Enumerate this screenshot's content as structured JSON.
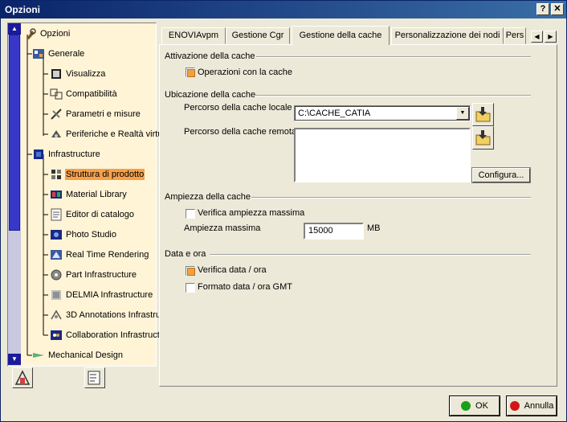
{
  "window": {
    "title": "Opzioni",
    "help_glyph": "?",
    "close_glyph": "✕"
  },
  "tree": {
    "items": [
      {
        "label": "Opzioni",
        "icon": "options-root-icon",
        "level": 0
      },
      {
        "label": "Generale",
        "icon": "general-icon",
        "level": 1
      },
      {
        "label": "Visualizza",
        "icon": "display-icon",
        "level": 2
      },
      {
        "label": "Compatibilità",
        "icon": "compatibility-icon",
        "level": 2
      },
      {
        "label": "Parametri e misure",
        "icon": "parameters-icon",
        "level": 2
      },
      {
        "label": "Periferiche e Realtà virtu",
        "icon": "devices-icon",
        "level": 2
      },
      {
        "label": "Infrastructure",
        "icon": "infrastructure-icon",
        "level": 1
      },
      {
        "label": "Struttura di prodotto",
        "icon": "product-structure-icon",
        "level": 2,
        "selected": true
      },
      {
        "label": "Material Library",
        "icon": "material-library-icon",
        "level": 2
      },
      {
        "label": "Editor di catalogo",
        "icon": "catalog-editor-icon",
        "level": 2
      },
      {
        "label": "Photo Studio",
        "icon": "photo-studio-icon",
        "level": 2
      },
      {
        "label": "Real Time Rendering",
        "icon": "rendering-icon",
        "level": 2
      },
      {
        "label": "Part Infrastructure",
        "icon": "gear-icon",
        "level": 2
      },
      {
        "label": "DELMIA Infrastructure",
        "icon": "delmia-icon",
        "level": 2
      },
      {
        "label": "3D Annotations Infrastru",
        "icon": "annotations-icon",
        "level": 2
      },
      {
        "label": "Collaboration Infrastructu",
        "icon": "collaboration-icon",
        "level": 2
      },
      {
        "label": "Mechanical Design",
        "icon": "mechanical-design-icon",
        "level": 1
      }
    ]
  },
  "tabs": [
    {
      "label": "ENOVIAvpm"
    },
    {
      "label": "Gestione Cgr"
    },
    {
      "label": "Gestione della cache",
      "active": true
    },
    {
      "label": "Personalizzazione dei nodi"
    },
    {
      "label": "Pers"
    }
  ],
  "tab_scroll": {
    "left": "◀",
    "right": "▶"
  },
  "cache_activation": {
    "title": "Attivazione della cache",
    "operations_label": "Operazioni con la cache",
    "operations_checked": true
  },
  "cache_location": {
    "title": "Ubicazione della cache",
    "local_path_label": "Percorso della cache locale",
    "local_path_value": "C:\\CACHE_CATIA",
    "remote_path_label": "Percorso della cache remota",
    "remote_path_value": "",
    "configure_label": "Configura...",
    "combo_arrow": "▼"
  },
  "cache_size": {
    "title": "Ampiezza della cache",
    "verify_label": "Verifica ampiezza massima",
    "verify_checked": false,
    "max_label": "Ampiezza massima",
    "max_value": "15000",
    "unit": "MB"
  },
  "date_time": {
    "title": "Data e ora",
    "verify_label": "Verifica data / ora",
    "verify_checked": true,
    "gmt_label": "Formato data / ora GMT",
    "gmt_checked": false
  },
  "footer": {
    "ok_label": "OK",
    "cancel_label": "Annulla",
    "ok_color": "#1aa01a",
    "cancel_color": "#d01818"
  },
  "scroll": {
    "up": "▲",
    "down": "▼"
  }
}
